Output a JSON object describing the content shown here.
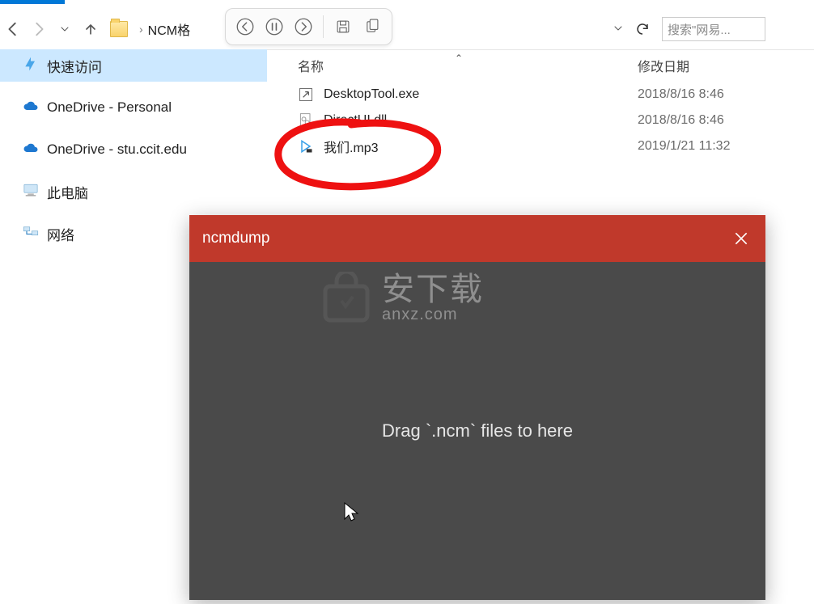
{
  "nav": {
    "breadcrumb": "NCM格",
    "search_placeholder": "搜索\"网易..."
  },
  "sidebar": {
    "items": [
      {
        "label": "快速访问"
      },
      {
        "label": "OneDrive - Personal"
      },
      {
        "label": "OneDrive - stu.ccit.edu"
      },
      {
        "label": "此电脑"
      },
      {
        "label": "网络"
      }
    ]
  },
  "columns": {
    "name": "名称",
    "date": "修改日期"
  },
  "files": [
    {
      "name": "DesktopTool.exe",
      "date": "2018/8/16 8:46",
      "icon": "shortcut"
    },
    {
      "name": "DirectUI.dll",
      "date": "2018/8/16 8:46",
      "icon": "dll"
    },
    {
      "name": "我们.mp3",
      "date": "2019/1/21 11:32",
      "icon": "media"
    }
  ],
  "app": {
    "title": "ncmdump",
    "drop_hint": "Drag `.ncm` files to here"
  },
  "watermark": {
    "top": "安下载",
    "bottom": "anxz.com"
  }
}
